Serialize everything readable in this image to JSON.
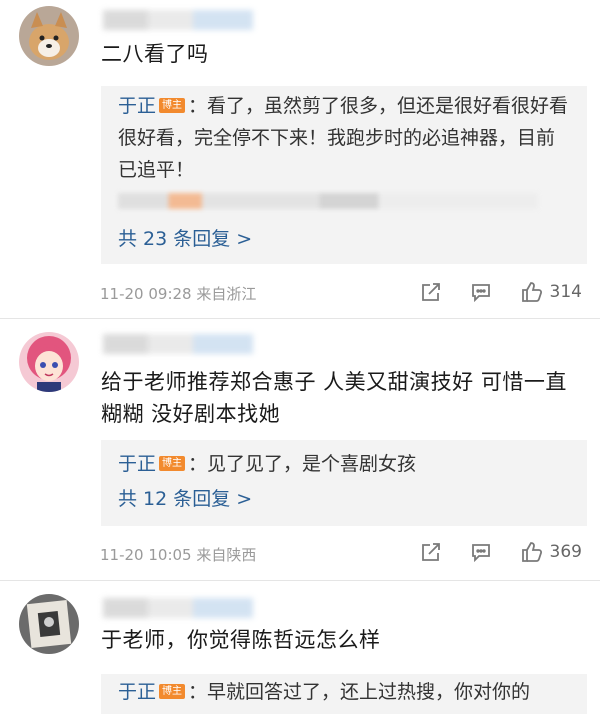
{
  "comments": [
    {
      "text": "二八看了吗",
      "reply": {
        "author": "于正",
        "badge": "博主",
        "text": "：看了，虽然剪了很多，但还是很好看很好看很好看，完全停不下来！我跑步时的必追神器，目前已追平！",
        "more": "共 23 条回复 >"
      },
      "meta": "11-20 09:28  来自浙江",
      "likes": "314"
    },
    {
      "text": "给于老师推荐郑合惠子 人美又甜演技好 可惜一直糊糊 没好剧本找她",
      "reply": {
        "author": "于正",
        "badge": "博主",
        "text": "：见了见了，是个喜剧女孩",
        "more": "共 12 条回复 >"
      },
      "meta": "11-20 10:05  来自陕西",
      "likes": "369"
    },
    {
      "text": "于老师，你觉得陈哲远怎么样",
      "reply": {
        "author": "于正",
        "badge": "博主",
        "text": "：早就回答过了，还上过热搜，你对你的"
      }
    }
  ],
  "icons": {
    "share": "share-icon",
    "comment": "comment-icon",
    "like": "thumbs-up-icon"
  }
}
